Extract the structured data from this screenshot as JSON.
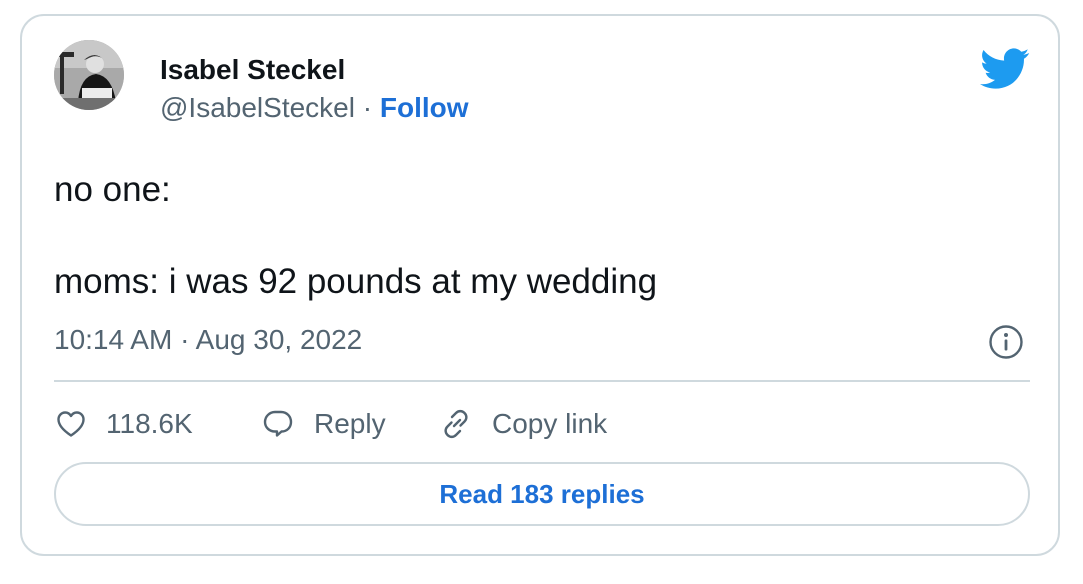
{
  "author": {
    "name": "Isabel Steckel",
    "handle": "@IsabelSteckel",
    "separator": "·",
    "follow_label": "Follow"
  },
  "tweet": {
    "lines": [
      "no one:",
      "moms: i was 92 pounds at my wedding"
    ],
    "time": "10:14 AM",
    "time_separator": "·",
    "date": "Aug 30, 2022"
  },
  "actions": {
    "likes": "118.6K",
    "reply_label": "Reply",
    "copy_link_label": "Copy link"
  },
  "read_replies_label": "Read 183 replies",
  "icons": {
    "brand": "twitter-bird-icon",
    "info": "info-icon",
    "like": "heart-icon",
    "reply": "speech-bubble-icon",
    "copy": "link-icon"
  },
  "colors": {
    "brand": "#1d9bf0",
    "link": "#1d6fd6",
    "text": "#0f1419",
    "muted": "#536471",
    "border": "#cfd9de"
  }
}
